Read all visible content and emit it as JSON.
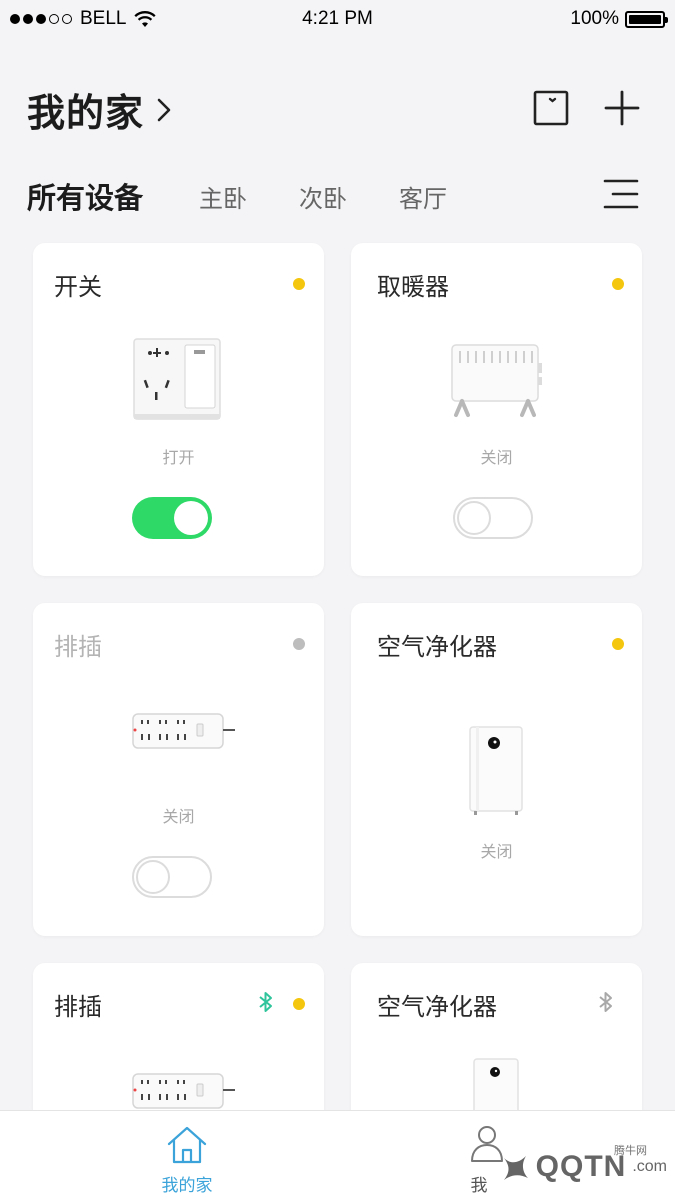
{
  "status_bar": {
    "carrier": "BELL",
    "time": "4:21 PM",
    "battery": "100%",
    "signal_bars": 3,
    "signal_total": 5
  },
  "header": {
    "title": "我的家",
    "chevron_icon": "chevron-right-icon",
    "device_view_icon": "square-icon",
    "add_icon": "plus-icon"
  },
  "tabs": {
    "items": [
      {
        "label": "所有设备",
        "active": true
      },
      {
        "label": "主卧",
        "active": false
      },
      {
        "label": "次卧",
        "active": false
      },
      {
        "label": "客厅",
        "active": false
      }
    ],
    "menu_icon": "menu-icon"
  },
  "colors": {
    "online": "#f4c60d",
    "offline": "#bdbdbd",
    "toggle_on": "#2ed968",
    "bluetooth_active": "#2fc49b",
    "bluetooth_inactive": "#a8a8a8",
    "accent": "#3ba3d9"
  },
  "devices": [
    {
      "name": "开关",
      "status": "打开",
      "online": true,
      "toggle": "on",
      "icon": "wall-switch-image"
    },
    {
      "name": "取暖器",
      "status": "关闭",
      "online": true,
      "toggle": "off",
      "icon": "heater-image"
    },
    {
      "name": "排插",
      "status": "关闭",
      "online": false,
      "toggle": "off",
      "icon": "power-strip-image"
    },
    {
      "name": "空气净化器",
      "status": "关闭",
      "online": true,
      "toggle": null,
      "icon": "air-purifier-image"
    },
    {
      "name": "排插",
      "status": "",
      "online": true,
      "bluetooth": "active",
      "icon": "power-strip-image"
    },
    {
      "name": "空气净化器",
      "status": "",
      "online": null,
      "bluetooth": "inactive",
      "icon": "air-purifier-image"
    }
  ],
  "bottom_tabs": [
    {
      "label": "我的家",
      "icon": "home-icon",
      "active": true
    },
    {
      "label": "我",
      "icon": "user-icon",
      "active": false
    }
  ],
  "watermark": {
    "text": "QQTN",
    "suffix": ".com",
    "small": "腾牛网"
  }
}
